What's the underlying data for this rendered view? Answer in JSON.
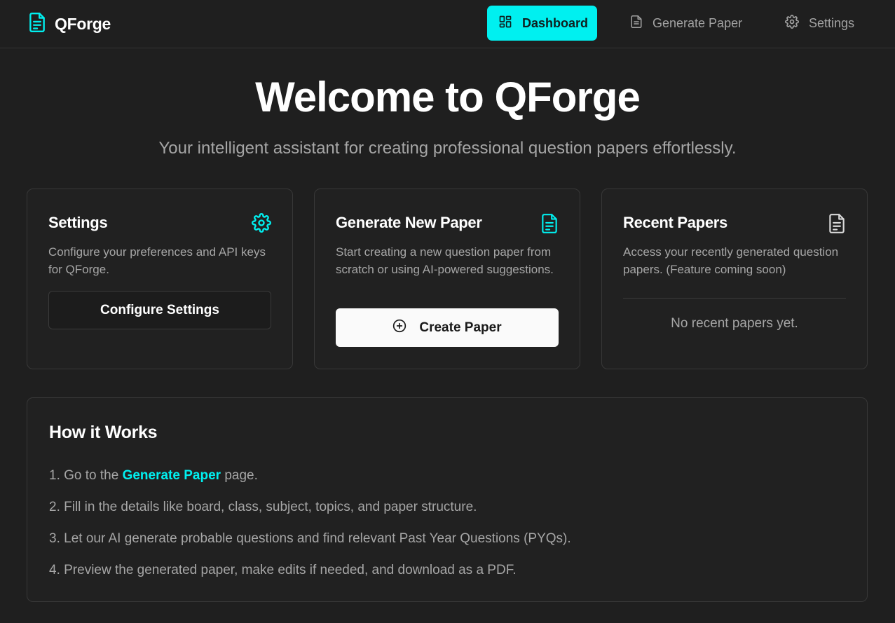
{
  "app": {
    "name": "QForge"
  },
  "nav": {
    "dashboard": "Dashboard",
    "generate": "Generate Paper",
    "settings": "Settings"
  },
  "hero": {
    "title": "Welcome to QForge",
    "subtitle": "Your intelligent assistant for creating professional question papers effortlessly."
  },
  "cards": {
    "settings": {
      "title": "Settings",
      "description": "Configure your preferences and API keys for QForge.",
      "button": "Configure Settings",
      "icon": "gear-icon"
    },
    "generate": {
      "title": "Generate New Paper",
      "description": "Start creating a new question paper from scratch or using AI-powered suggestions.",
      "button": "Create Paper",
      "icon": "file-text-icon"
    },
    "recent": {
      "title": "Recent Papers",
      "description": "Access your recently generated question papers. (Feature coming soon)",
      "empty": "No recent papers yet.",
      "icon": "file-text-icon"
    }
  },
  "how": {
    "title": "How it Works",
    "step1_prefix": "1. Go to the ",
    "step1_link": "Generate Paper",
    "step1_suffix": " page.",
    "step2": "2. Fill in the details like board, class, subject, topics, and paper structure.",
    "step3": "3. Let our AI generate probable questions and find relevant Past Year Questions (PYQs).",
    "step4": "4. Preview the generated paper, make edits if needed, and download as a PDF."
  },
  "colors": {
    "accent": "#00f0f0",
    "background": "#1f1f1f",
    "card": "#212121",
    "muted_text": "#a6a6a6"
  }
}
